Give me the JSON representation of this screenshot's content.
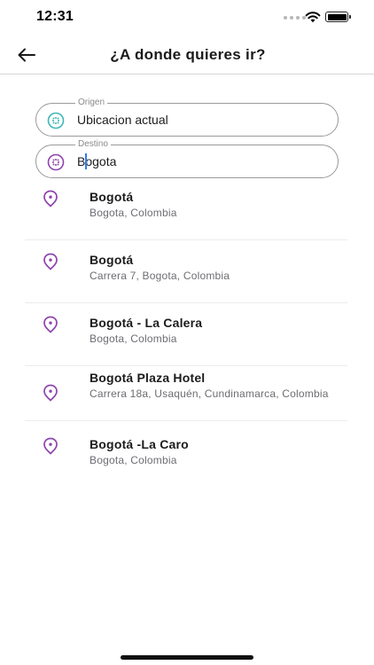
{
  "status_bar": {
    "time": "12:31"
  },
  "header": {
    "title": "¿A donde quieres ir?",
    "back_icon": "arrow-left-icon"
  },
  "origin": {
    "label": "Origen",
    "value": "Ubicacion actual",
    "icon": "location-dots-icon",
    "color": "#3fb6b6"
  },
  "destination": {
    "label": "Destino",
    "value": "Bogota",
    "icon": "location-dots-icon",
    "color": "#8e44ad"
  },
  "results": [
    {
      "title": "Bogotá",
      "subtitle": "Bogota, Colombia",
      "icon": "map-pin-icon"
    },
    {
      "title": "Bogotá",
      "subtitle": "Carrera 7, Bogota, Colombia",
      "icon": "map-pin-icon"
    },
    {
      "title": "Bogotá - La Calera",
      "subtitle": "Bogota, Colombia",
      "icon": "map-pin-icon"
    },
    {
      "title": "Bogotá Plaza Hotel",
      "subtitle": "Carrera 18a, Usaquén, Cundinamarca, Colombia",
      "icon": "map-pin-icon"
    },
    {
      "title": "Bogotá -La Caro",
      "subtitle": "Bogota, Colombia",
      "icon": "map-pin-icon"
    }
  ],
  "colors": {
    "accent": "#8e44ad",
    "origin": "#3fb6b6",
    "caret": "#2f7bf5"
  }
}
